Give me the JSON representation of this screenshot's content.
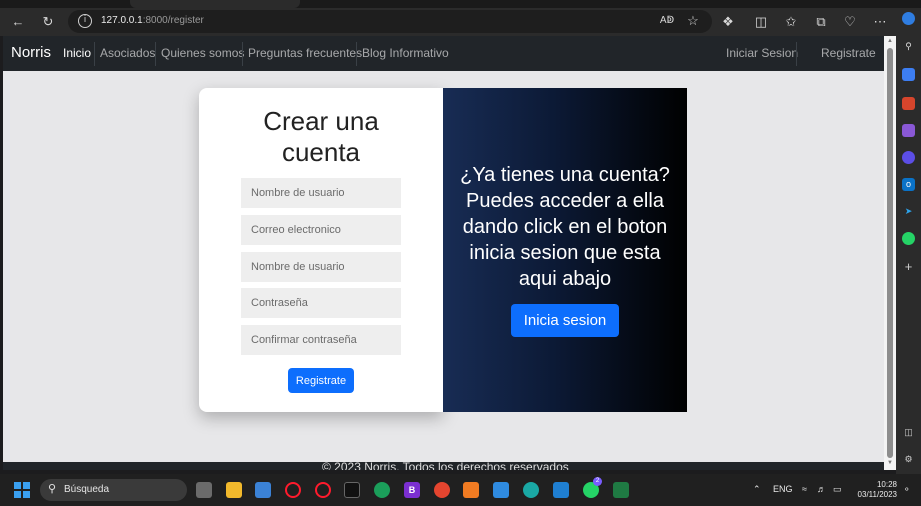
{
  "browser": {
    "url_host": "127.0.0.1",
    "url_path": ":8000/register",
    "toolbar_icons": [
      "back-icon",
      "refresh-icon",
      "read-aloud-icon",
      "favorite-star-icon",
      "extensions-icon",
      "split-screen-icon",
      "favorites-icon",
      "collections-icon",
      "performance-icon",
      "more-icon",
      "copilot-icon"
    ]
  },
  "navbar": {
    "brand": "Norris",
    "links": [
      "Inicio",
      "Asociados",
      "Quienes somos",
      "Preguntas frecuentes",
      "Blog Informativo"
    ],
    "login": "Iniciar Sesion",
    "register": "Registrate"
  },
  "register_form": {
    "title_line1": "Crear una",
    "title_line2": "cuenta",
    "username_placeholder": "Nombre de usuario",
    "email_placeholder": "Correo electronico",
    "username2_placeholder": "Nombre de usuario",
    "password_placeholder": "Contraseña",
    "confirm_placeholder": "Confirmar contraseña",
    "submit_label": "Registrate"
  },
  "login_panel": {
    "line1": "¿Ya tienes una cuenta?",
    "line2": "Puedes acceder a ella",
    "line3": "dando click en el boton",
    "line4": "inicia sesion que esta",
    "line5": "aqui abajo",
    "button_label": "Inicia sesion"
  },
  "footer": {
    "text": "© 2023 Norris. Todos los derechos reservados"
  },
  "taskbar": {
    "search_label": "Búsqueda",
    "language": "ENG",
    "time": "10:28",
    "date": "03/11/2023",
    "whatsapp_badge": "2"
  },
  "colors": {
    "primary": "#0d6efd",
    "navbar": "#212529",
    "page_bg": "#e7e7e9"
  }
}
